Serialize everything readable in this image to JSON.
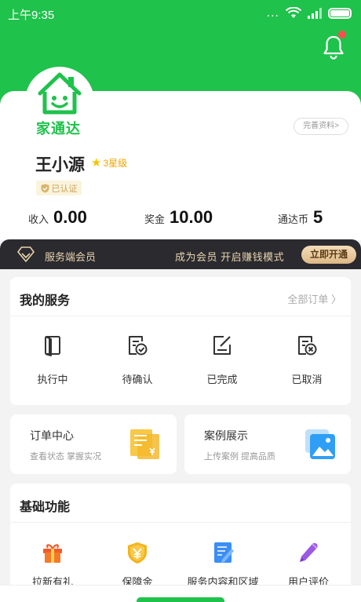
{
  "status_bar": {
    "time": "上午9:35",
    "dots": "..."
  },
  "brand": {
    "logo_text": "家通达"
  },
  "profile": {
    "complete_label": "完善资料>",
    "name": "王小源",
    "level": "3星级",
    "verified": "已认证"
  },
  "stats": [
    {
      "label": "收入",
      "value": "0.00"
    },
    {
      "label": "奖金",
      "value": "10.00"
    },
    {
      "label": "通达币",
      "value": "5"
    }
  ],
  "vip": {
    "title": "服务端会员",
    "promo": "成为会员  开启赚钱模式",
    "button": "立即开通"
  },
  "my_services": {
    "title": "我的服务",
    "all_orders": "全部订单 〉",
    "items": [
      {
        "label": "执行中",
        "icon": "in-progress-icon"
      },
      {
        "label": "待确认",
        "icon": "pending-icon"
      },
      {
        "label": "已完成",
        "icon": "completed-icon"
      },
      {
        "label": "已取消",
        "icon": "cancelled-icon"
      }
    ]
  },
  "cards": [
    {
      "title": "订单中心",
      "subtitle": "查看状态  掌握实况",
      "icon": "order-center-icon"
    },
    {
      "title": "案例展示",
      "subtitle": "上传案例  提高品质",
      "icon": "case-gallery-icon"
    }
  ],
  "basic_functions": {
    "title": "基础功能",
    "items": [
      {
        "label": "拉新有礼",
        "icon": "gift-icon"
      },
      {
        "label": "保障金",
        "icon": "shield-yen-icon"
      },
      {
        "label": "服务内容和区域",
        "icon": "document-edit-icon"
      },
      {
        "label": "用户评价",
        "icon": "pencil-icon"
      }
    ]
  },
  "colors": {
    "brand_green": "#1fc24b",
    "vip_dark": "#2a2a2f",
    "gold": "#e8d3ae"
  }
}
